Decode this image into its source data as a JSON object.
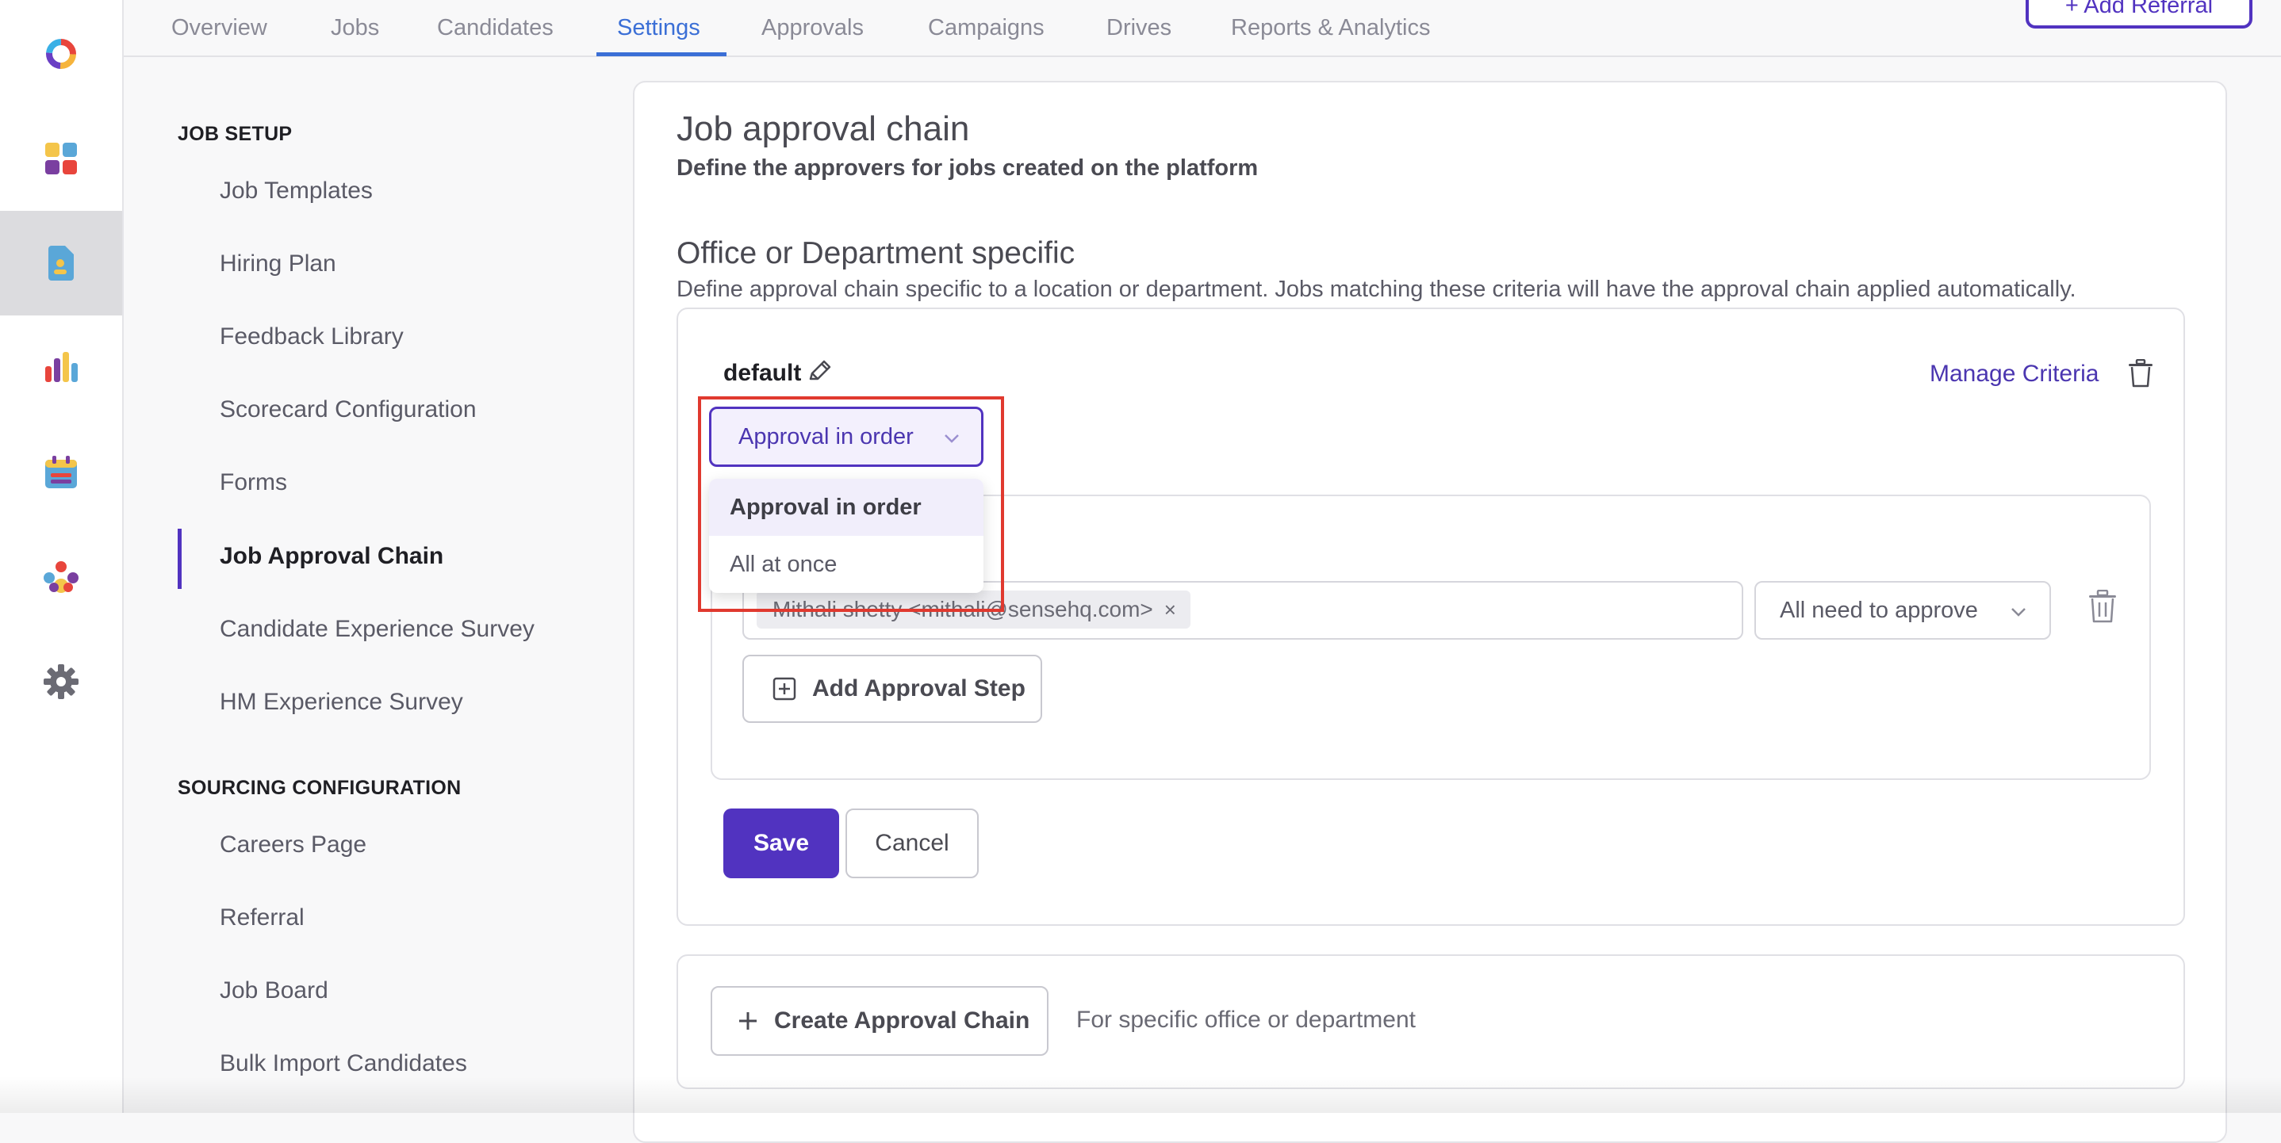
{
  "nav": {
    "tabs": [
      {
        "label": "Overview"
      },
      {
        "label": "Jobs"
      },
      {
        "label": "Candidates"
      },
      {
        "label": "Settings"
      },
      {
        "label": "Approvals"
      },
      {
        "label": "Campaigns"
      },
      {
        "label": "Drives"
      },
      {
        "label": "Reports & Analytics"
      }
    ],
    "active_tab": "Settings",
    "action_label": "+ Add Referral"
  },
  "rail": {
    "icons": [
      "app-logo-icon",
      "dashboard-grid-icon",
      "job-document-icon",
      "analytics-bars-icon",
      "calendar-icon",
      "people-network-icon",
      "settings-gear-icon"
    ],
    "active_icon": "job-document-icon"
  },
  "sidebar": {
    "job_setup_heading": "JOB SETUP",
    "job_setup_items": [
      {
        "label": "Job Templates"
      },
      {
        "label": "Hiring Plan"
      },
      {
        "label": "Feedback Library"
      },
      {
        "label": "Scorecard Configuration"
      },
      {
        "label": "Forms"
      },
      {
        "label": "Job Approval Chain"
      },
      {
        "label": "Candidate Experience Survey"
      },
      {
        "label": "HM Experience Survey"
      }
    ],
    "active_item": "Job Approval Chain",
    "sourcing_heading": "SOURCING CONFIGURATION",
    "sourcing_items": [
      {
        "label": "Careers Page"
      },
      {
        "label": "Referral"
      },
      {
        "label": "Job Board"
      },
      {
        "label": "Bulk Import Candidates"
      }
    ]
  },
  "main": {
    "title": "Job approval chain",
    "subtitle": "Define the approvers for jobs created on the platform",
    "section_title": "Office or Department specific",
    "section_description": "Define approval chain specific to a location or department. Jobs matching these criteria will have the approval chain applied automatically.",
    "chain": {
      "name": "default",
      "manage_criteria": "Manage Criteria",
      "mode_select_value": "Approval in order",
      "mode_options": [
        {
          "label": "Approval in order",
          "selected": true
        },
        {
          "label": "All at once",
          "selected": false
        }
      ],
      "approver_chip": "Mithali shetty <mithali@sensehq.com>",
      "chip_remove": "×",
      "rule_select_value": "All need to approve",
      "add_step_label": "Add Approval Step",
      "save_label": "Save",
      "cancel_label": "Cancel"
    },
    "create": {
      "button_label": "Create Approval Chain",
      "hint": "For specific office or department"
    }
  },
  "colors": {
    "accent": "#5133c0",
    "tab_active": "#3b6fd6",
    "highlight": "#e0392f"
  }
}
